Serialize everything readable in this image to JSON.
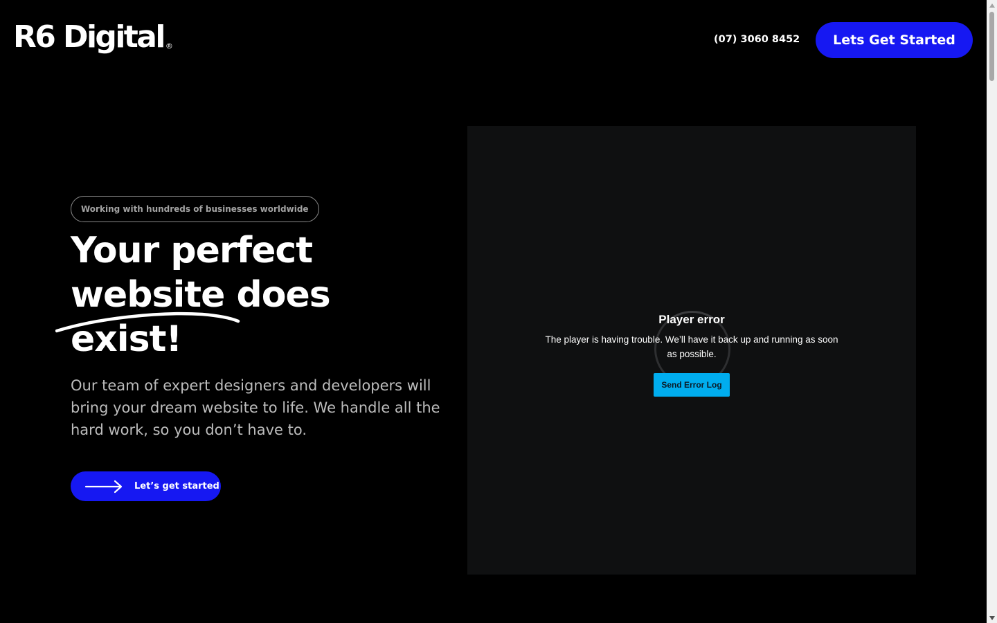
{
  "header": {
    "logo": "R6 Digital",
    "logo_mark": "®",
    "phone": "(07) 3060 8452",
    "cta_label": "Lets Get Started"
  },
  "hero": {
    "badge": "Working with hundreds of businesses worldwide",
    "headline_lines": [
      "Your perfect",
      "website does",
      "exist!"
    ],
    "subtext": "Our team of expert designers and developers will bring your dream website to life. We handle all the hard work, so you don’t have to.",
    "cta_label": "Let’s get started",
    "cta_icon": "arrow-right-icon"
  },
  "player": {
    "error_title": "Player error",
    "error_message": "The player is having trouble. We’ll have it back up and running as soon as possible.",
    "send_log_label": "Send Error Log"
  },
  "colors": {
    "background": "#000000",
    "accent_blue": "#1618f2",
    "player_bg": "#0f1011",
    "send_log_bg": "#00adef",
    "subtext": "#bdbdbd"
  }
}
